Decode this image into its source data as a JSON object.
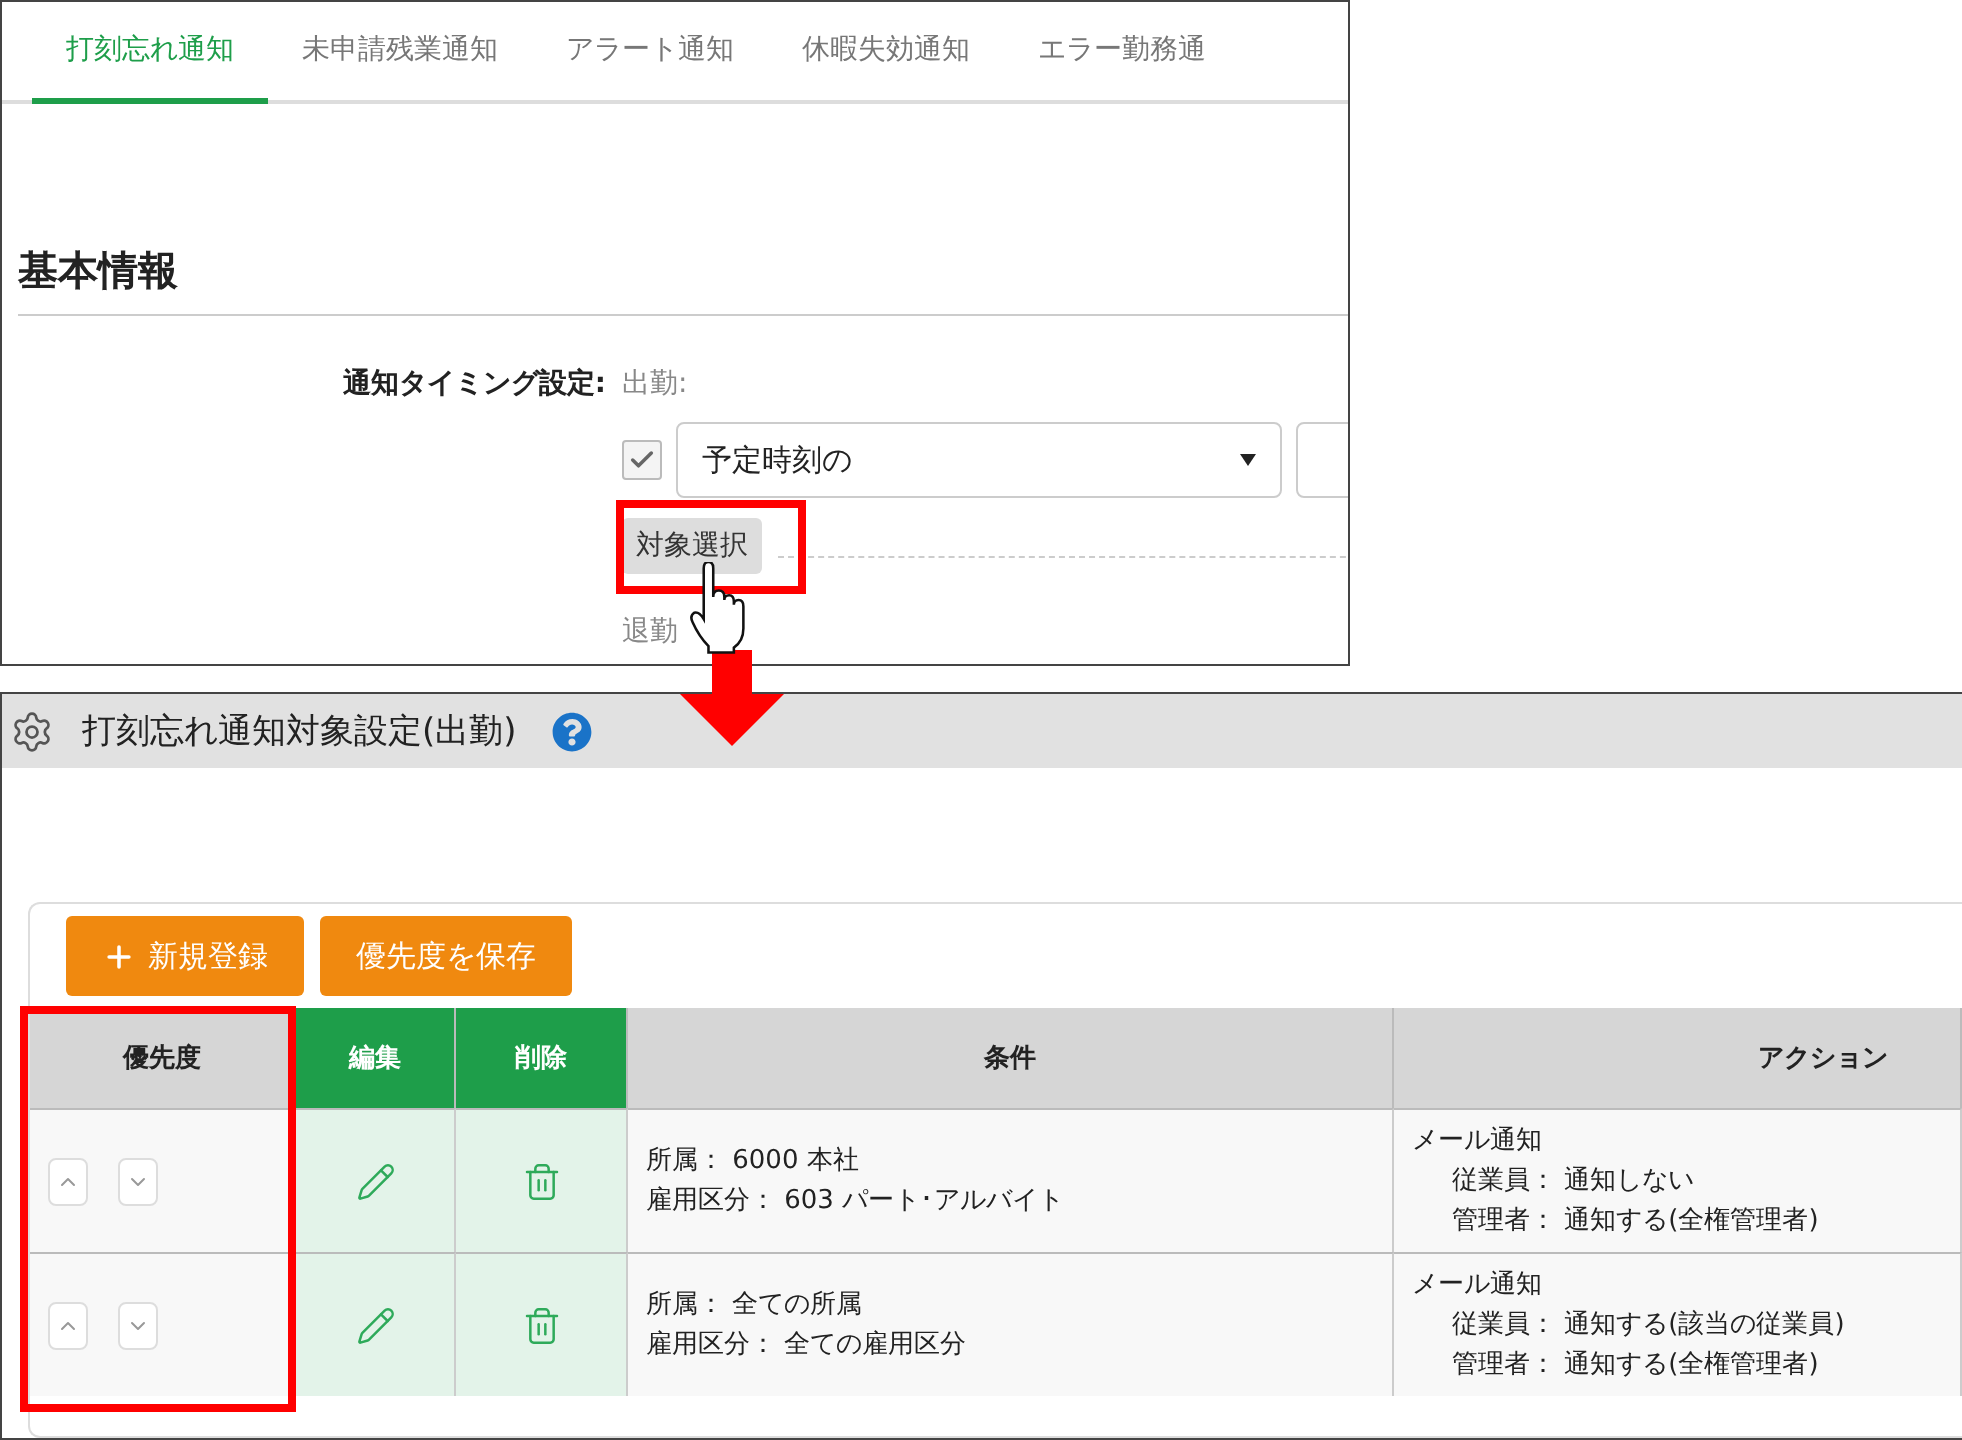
{
  "tabs": [
    {
      "label": "打刻忘れ通知",
      "selected": true
    },
    {
      "label": "未申請残業通知",
      "selected": false
    },
    {
      "label": "アラート通知",
      "selected": false
    },
    {
      "label": "休暇失効通知",
      "selected": false
    },
    {
      "label": "エラー勤務通",
      "selected": false
    }
  ],
  "section_title": "基本情報",
  "form": {
    "label": "通知タイミング設定:",
    "clock_in_label": "出勤:",
    "checked": true,
    "timing_select": "予定時刻の",
    "target_button": "対象選択",
    "clock_out_label": "退勤"
  },
  "dialog": {
    "title": "打刻忘れ通知対象設定(出勤)",
    "buttons": [
      {
        "label": "新規登録",
        "kind": "add"
      },
      {
        "label": "優先度を保存",
        "kind": "save"
      }
    ],
    "table": {
      "columns": [
        {
          "label": "優先度",
          "kind": "priority"
        },
        {
          "label": "編集",
          "kind": "edit"
        },
        {
          "label": "削除",
          "kind": "delete"
        },
        {
          "label": "条件",
          "kind": "condition"
        },
        {
          "label": "アクション",
          "kind": "action"
        }
      ],
      "rows": [
        {
          "conditions": [
            "所属： 6000 本社",
            "雇用区分： 603 パート･アルバイト"
          ],
          "action_title": "メール通知",
          "action_lines": [
            "従業員： 通知しない",
            "管理者： 通知する(全権管理者)"
          ]
        },
        {
          "conditions": [
            "所属： 全ての所属",
            "雇用区分： 全ての雇用区分"
          ],
          "action_title": "メール通知",
          "action_lines": [
            "従業員： 通知する(該当の従業員)",
            "管理者： 通知する(全権管理者)"
          ]
        }
      ]
    }
  }
}
